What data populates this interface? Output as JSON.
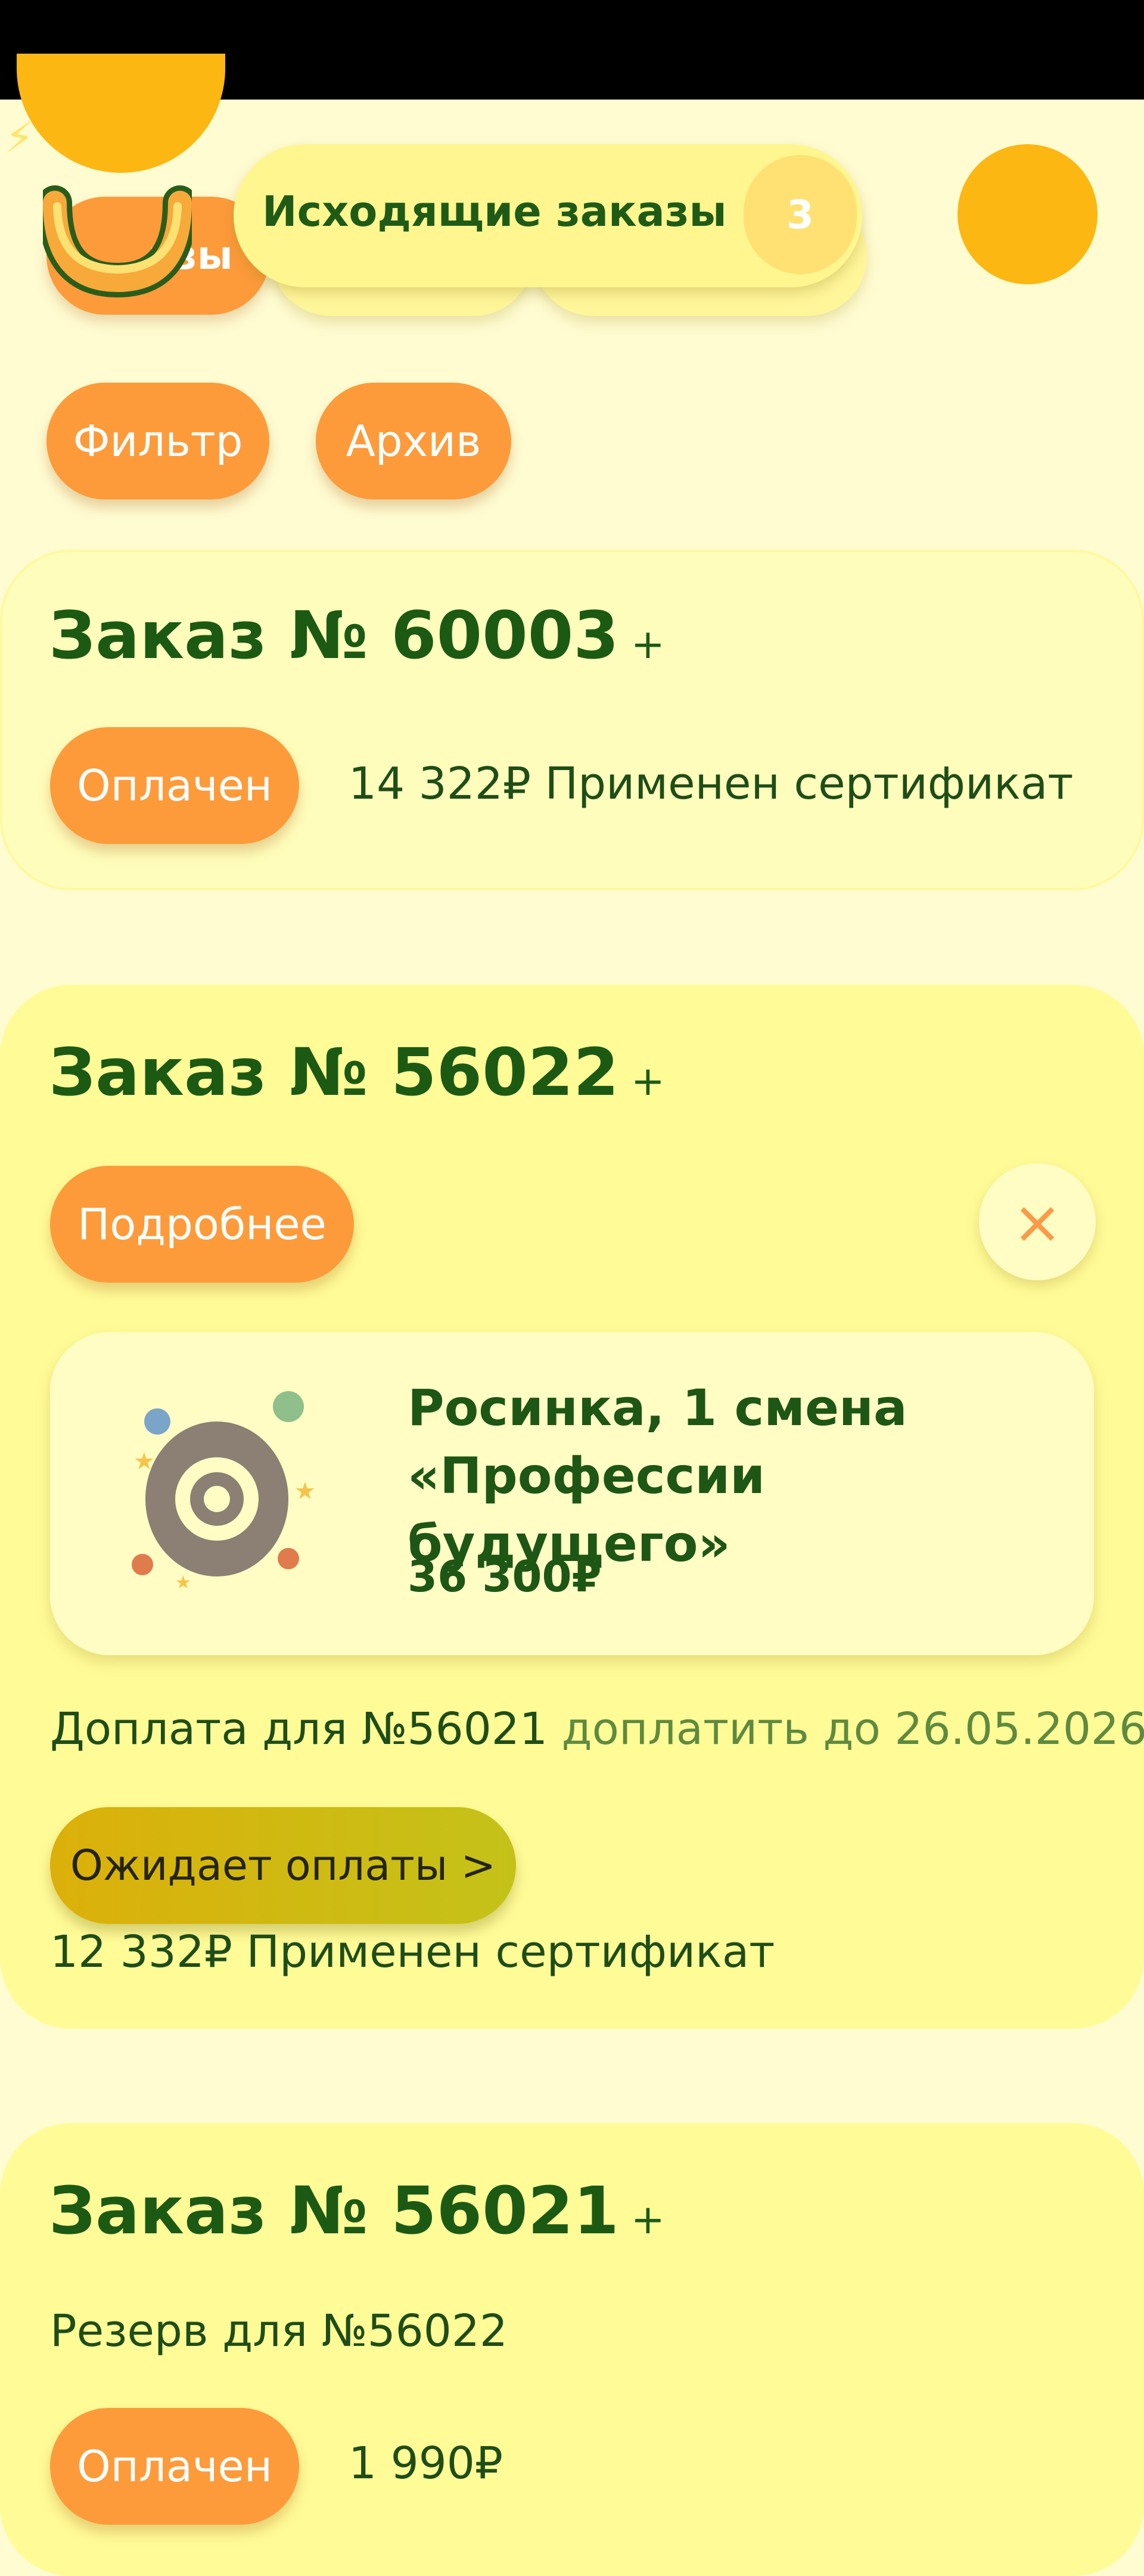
{
  "header": {
    "outgoing_label": "Исходящие заказы",
    "outgoing_count": "3",
    "orders_tab_partial": "азы"
  },
  "filters": {
    "filter_label": "Фильтр",
    "archive_label": "Архив"
  },
  "orders": [
    {
      "title": "Заказ № 60003",
      "plus": "+",
      "status": "Оплачен",
      "price_note": "14 322₽ Применен сертификат"
    },
    {
      "title": "Заказ № 56022",
      "plus": "+",
      "details_label": "Подробнее",
      "close_icon": "×",
      "product": {
        "name_line1": "Росинка, 1 смена",
        "name_line2": "«Профессии будущего»",
        "price": "36 300₽"
      },
      "surcharge_text": "Доплата для №56021",
      "deadline_text": "доплатить до 26.05.2026",
      "pending_label": "Ожидает оплаты >",
      "price_note": "12 332₽ Применен сертификат"
    },
    {
      "title": "Заказ № 56021",
      "plus": "+",
      "reserve_text": "Резерв для №56022",
      "status": "Оплачен",
      "price": "1 990₽"
    }
  ]
}
